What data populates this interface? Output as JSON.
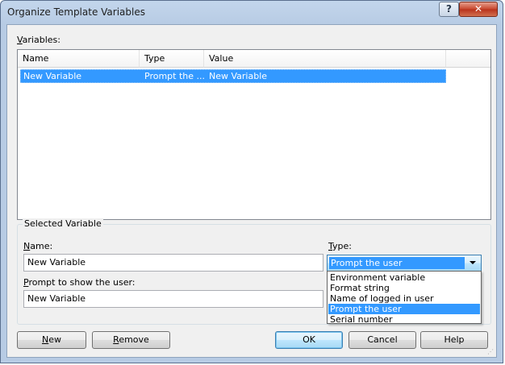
{
  "window": {
    "title": "Organize Template Variables",
    "help_glyph": "?",
    "close_glyph": "✕"
  },
  "variables_label": "Variables:",
  "table": {
    "columns": [
      "Name",
      "Type",
      "Value"
    ],
    "rows": [
      {
        "name": "New Variable",
        "type": "Prompt the ...",
        "value": "New Variable"
      }
    ]
  },
  "selected_group": {
    "title": "Selected Variable",
    "name_label": "Name:",
    "name_value": "New Variable",
    "type_label": "Type:",
    "type_value": "Prompt the user",
    "prompt_label": "Prompt to show the user:",
    "prompt_value": "New Variable"
  },
  "type_options": [
    {
      "label": "Environment variable",
      "selected": false
    },
    {
      "label": "Format string",
      "selected": false
    },
    {
      "label": "Name of logged in user",
      "selected": false
    },
    {
      "label": "Prompt the user",
      "selected": true
    },
    {
      "label": "Serial number",
      "selected": false
    }
  ],
  "buttons": {
    "new": "New",
    "remove": "Remove",
    "ok": "OK",
    "cancel": "Cancel",
    "help": "Help"
  },
  "colors": {
    "selection": "#3399ff",
    "title_bar": "#c3d6ec",
    "close_button": "#c7452c"
  }
}
